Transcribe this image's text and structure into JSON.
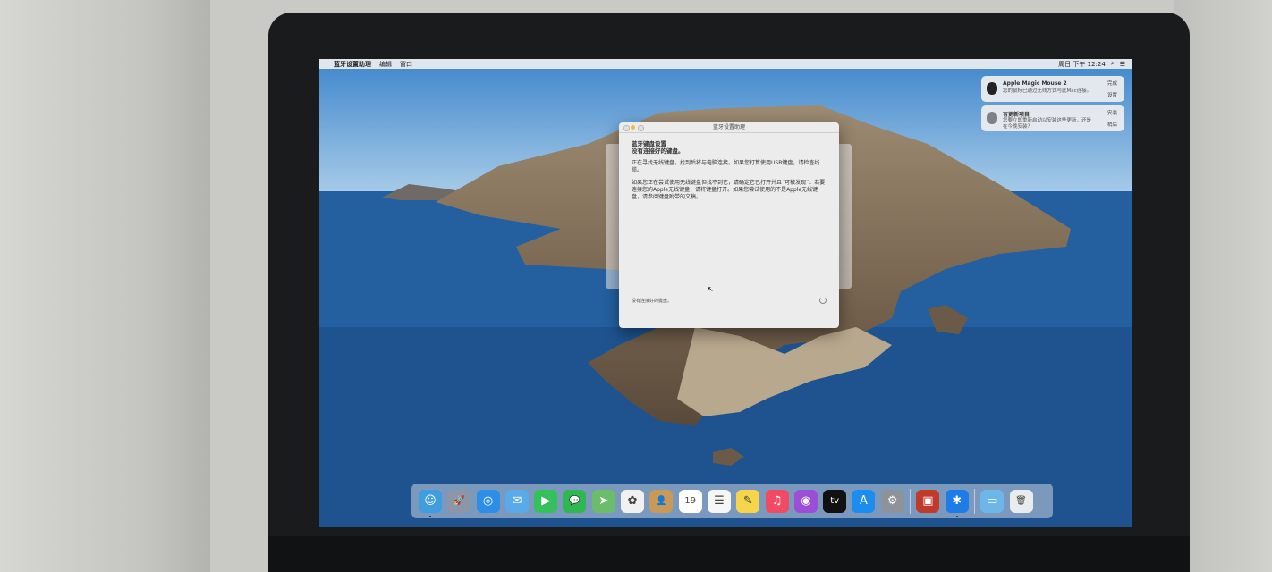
{
  "menubar": {
    "app_name": "蓝牙设置助理",
    "items": [
      "编辑",
      "窗口"
    ],
    "clock": "周日 下午 12:24"
  },
  "notifications": [
    {
      "title": "Apple Magic Mouse 2",
      "body": "您的鼠标已通过无线方式与此Mac连接。",
      "action1": "完成",
      "action2": "设置"
    },
    {
      "title": "有更新项目",
      "body": "您要立即重新启动以安装这些更新，还是在今晚安装？",
      "action1": "安装",
      "action2": "稍后"
    }
  ],
  "dialog": {
    "window_title": "蓝牙设置助理",
    "heading": "蓝牙键盘设置",
    "subheading": "没有连接好的键盘。",
    "paragraph1": "正在寻找无线键盘，找到后将与电脑连接。如果您打算使用USB键盘，请检查线缆。",
    "paragraph2": "如果您正在尝试使用无线键盘但找不到它，请确定它已打开并且“可被发现”。若要连接您的Apple无线键盘，请将键盘打开。如果您尝试使用的不是Apple无线键盘，请参阅键盘附带的文稿。",
    "status": "没有连接好的键盘。"
  },
  "dock": {
    "apps": [
      {
        "name": "finder-icon",
        "glyph": "☺",
        "color": "#3f9de0"
      },
      {
        "name": "launchpad-icon",
        "glyph": "🚀",
        "color": "#8b96a8"
      },
      {
        "name": "safari-icon",
        "glyph": "◎",
        "color": "#2d8ee8"
      },
      {
        "name": "mail-icon",
        "glyph": "✉",
        "color": "#5aa9e8"
      },
      {
        "name": "facetime-icon",
        "glyph": "▶",
        "color": "#34c05a"
      },
      {
        "name": "messages-icon",
        "glyph": "💬",
        "color": "#2fb84f"
      },
      {
        "name": "maps-icon",
        "glyph": "➤",
        "color": "#6cbd6a"
      },
      {
        "name": "photos-icon",
        "glyph": "✿",
        "color": "#f1f1f1"
      },
      {
        "name": "contacts-icon",
        "glyph": "👤",
        "color": "#c79a5a"
      },
      {
        "name": "calendar-icon",
        "glyph": "19",
        "color": "#ffffff"
      },
      {
        "name": "reminders-icon",
        "glyph": "☰",
        "color": "#f6f6f6"
      },
      {
        "name": "notes-icon",
        "glyph": "✎",
        "color": "#f7d54a"
      },
      {
        "name": "music-icon",
        "glyph": "♫",
        "color": "#f04a64"
      },
      {
        "name": "podcasts-icon",
        "glyph": "◉",
        "color": "#9b4fd6"
      },
      {
        "name": "apple-tv-icon",
        "glyph": "tv",
        "color": "#111111"
      },
      {
        "name": "app-store-icon",
        "glyph": "A",
        "color": "#1b8cf0"
      },
      {
        "name": "system-preferences-icon",
        "glyph": "⚙",
        "color": "#8e939a"
      },
      {
        "name": "photo-booth-icon",
        "glyph": "▣",
        "color": "#c0392b"
      },
      {
        "name": "bluetooth-setup-icon",
        "glyph": "✱",
        "color": "#1d7ce8"
      }
    ],
    "folders": [
      {
        "name": "downloads-folder-icon",
        "glyph": "▭",
        "color": "#6cb6ea"
      },
      {
        "name": "trash-icon",
        "glyph": "🗑",
        "color": "#e8ecef"
      }
    ]
  }
}
